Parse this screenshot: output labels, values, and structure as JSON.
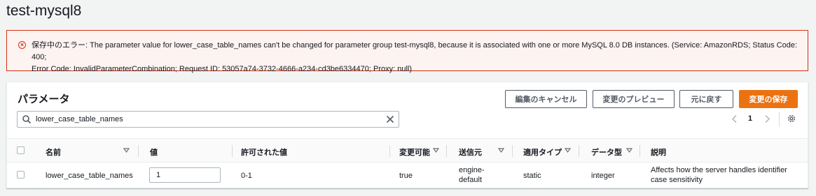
{
  "page": {
    "title": "test-mysql8"
  },
  "error": {
    "line1": "保存中のエラー: The parameter value for lower_case_table_names can't be changed for parameter group test-mysql8, because it is associated with one or more MySQL 8.0 DB instances. (Service: AmazonRDS; Status Code: 400;",
    "line2": "Error Code: InvalidParameterCombination; Request ID: 53057a74-3732-4666-a234-cd3be6334470; Proxy: null)",
    "icon": "error-circle-icon",
    "color": "#d13212"
  },
  "panel": {
    "title": "パラメータ",
    "buttons": {
      "cancel_edit": "編集のキャンセル",
      "preview": "変更のプレビュー",
      "reset": "元に戻す",
      "save": "変更の保存"
    },
    "search": {
      "value": "lower_case_table_names"
    },
    "pagination": {
      "current_page": "1"
    }
  },
  "table": {
    "headers": [
      "名前",
      "値",
      "許可された値",
      "変更可能",
      "送信元",
      "適用タイプ",
      "データ型",
      "説明"
    ],
    "rows": [
      {
        "name": "lower_case_table_names",
        "value": "1",
        "allowed_values": "0-1",
        "modifiable": "true",
        "source_line1": "engine-",
        "source_line2": "default",
        "apply_type": "static",
        "data_type": "integer",
        "description_line1": "Affects how the server handles identifier",
        "description_line2": "case sensitivity"
      }
    ]
  },
  "colors": {
    "accent": "#ec7211",
    "error": "#d13212",
    "text": "#16191f"
  }
}
